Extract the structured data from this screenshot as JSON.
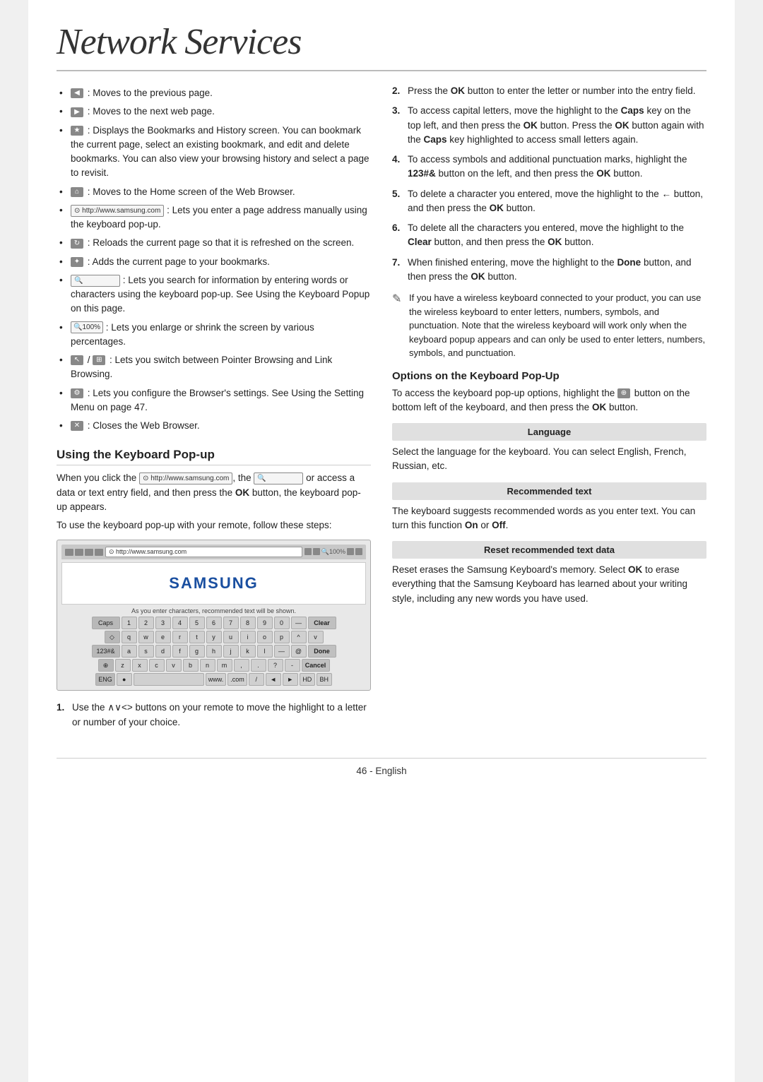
{
  "title": "Network Services",
  "left_bullets": [
    {
      "icon": "back-arrow-icon",
      "text": ": Moves to the previous page."
    },
    {
      "icon": "forward-arrow-icon",
      "text": ": Moves to the next web page."
    },
    {
      "icon": "bookmarks-icon",
      "text": ": Displays the Bookmarks and History screen. You can bookmark the current page, select an existing bookmark, and edit and delete bookmarks. You can also view your browsing history and select a page to revisit."
    },
    {
      "icon": "home-icon",
      "text": ": Moves to the Home screen of the Web Browser."
    },
    {
      "icon": "url-bar-icon",
      "text": ": Lets you enter a page address manually using the keyboard pop-up."
    },
    {
      "icon": "reload-icon",
      "text": ": Reloads the current page so that it is refreshed on the screen."
    },
    {
      "icon": "bookmark-add-icon",
      "text": ": Adds the current page to your bookmarks."
    },
    {
      "icon": "search-bar-icon",
      "text": ": Lets you search for information by entering words or characters using the keyboard pop-up. See Using the Keyboard Popup on this page."
    },
    {
      "icon": "zoom-icon",
      "text": ": Lets you enlarge or shrink the screen by various percentages."
    },
    {
      "icon": "pointer-icon",
      "text": "/  : Lets you switch between Pointer Browsing and Link Browsing."
    },
    {
      "icon": "settings-icon",
      "text": ": Lets you configure the Browser’s settings. See Using the Setting Menu on page 47."
    },
    {
      "icon": "close-icon",
      "text": ": Closes the Web Browser."
    }
  ],
  "keyboard_section": {
    "title": "Using the Keyboard Pop-up",
    "intro1": "When you click the",
    "url_icon_text": "http://www.samsung.com",
    "intro2": ", the",
    "intro3": "or access a data or text entry field, and then press the OK button, the keyboard pop-up appears.",
    "intro4": "To use the keyboard pop-up with your remote, follow these steps:",
    "keyboard_url": "http://www.samsung.com",
    "hint_text": "As you enter characters, recommended text will be shown.",
    "rows": [
      [
        "Caps",
        "1",
        "2",
        "3",
        "4",
        "5",
        "6",
        "7",
        "8",
        "9",
        "0",
        "—",
        "Clear"
      ],
      [
        "◇",
        "q",
        "w",
        "e",
        "r",
        "t",
        "y",
        "u",
        "i",
        "o",
        "p",
        "^",
        "v"
      ],
      [
        "123#&",
        "a",
        "s",
        "d",
        "f",
        "g",
        "h",
        "j",
        "k",
        "l",
        "—",
        "@",
        "Done"
      ],
      [
        "⊕",
        "z",
        "x",
        "c",
        "v",
        "b",
        "n",
        "m",
        ",",
        ".",
        "?",
        "-",
        "Cancel"
      ],
      [
        "ENG",
        "●",
        "",
        "",
        "www.",
        ".com",
        "/",
        "◄",
        "►",
        "HD",
        "BH"
      ]
    ]
  },
  "ordered_steps": [
    {
      "num": "1.",
      "text": "Use the ∧∨<> buttons on your remote to move the highlight to a letter or number of your choice."
    },
    {
      "num": "2.",
      "text": "Press the OK button to enter the letter or number into the entry field."
    },
    {
      "num": "3.",
      "text": "To access capital letters, move the highlight to the Caps key on the top left, and then press the OK button. Press the OK button again with the Caps key highlighted to access small letters again."
    },
    {
      "num": "4.",
      "text": "To access symbols and additional punctuation marks, highlight the 123#& button on the left, and then press the OK button."
    },
    {
      "num": "5.",
      "text": "To delete a character you entered, move the highlight to the ← button, and then press the OK button."
    },
    {
      "num": "6.",
      "text": "To delete all the characters you entered, move the highlight to the Clear button, and then press the OK button."
    },
    {
      "num": "7.",
      "text": "When finished entering, move the highlight to the Done button, and then press the OK button."
    }
  ],
  "wireless_note": "If you have a wireless keyboard connected to your product, you can use the wireless keyboard to enter letters, numbers, symbols, and punctuation. Note that the wireless keyboard will work only when the keyboard popup appears and can only be used to enter letters, numbers, symbols, and punctuation.",
  "options_section": {
    "heading": "Options on the Keyboard Pop-Up",
    "intro": "To access the keyboard pop-up options, highlight the",
    "intro2": "button on the bottom left of the keyboard, and then press the OK button.",
    "subsections": [
      {
        "label": "Language",
        "text": "Select the language for the keyboard. You can select English, French, Russian, etc."
      },
      {
        "label": "Recommended text",
        "text": "The keyboard suggests recommended words as you enter text. You can turn this function On or Off."
      },
      {
        "label": "Reset recommended text data",
        "text": "Reset erases the Samsung Keyboard's memory. Select OK to erase everything that the Samsung Keyboard has learned about your writing style, including any new words you have used."
      }
    ]
  },
  "footer": "46 - English"
}
